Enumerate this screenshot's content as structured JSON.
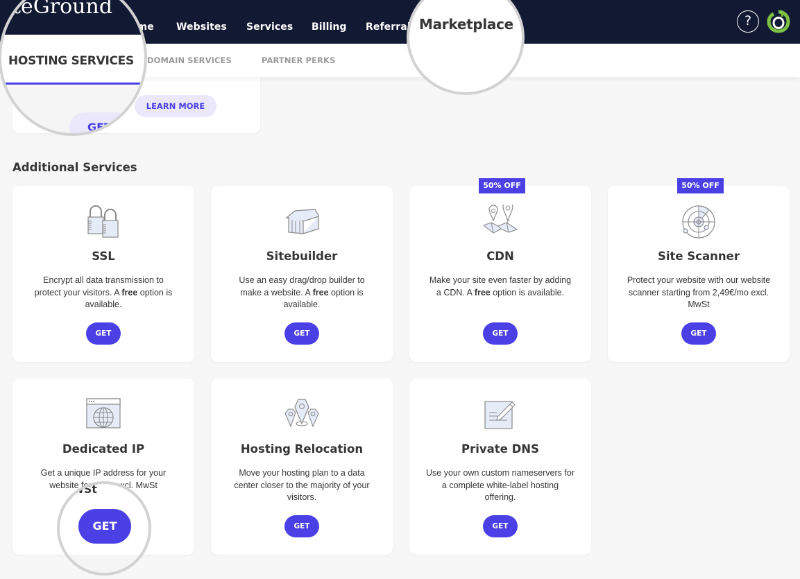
{
  "topnav": {
    "logo_text": "SiteGround",
    "items": [
      {
        "label": "Home"
      },
      {
        "label": "Websites"
      },
      {
        "label": "Services"
      },
      {
        "label": "Billing"
      },
      {
        "label": "Referrals"
      },
      {
        "label": "Marketplace"
      }
    ],
    "help_icon": "?"
  },
  "subnav": {
    "tabs": [
      {
        "label": "HOSTING SERVICES",
        "active": true
      },
      {
        "label": "DOMAIN SERVICES",
        "active": false
      },
      {
        "label": "PARTNER PERKS",
        "active": false
      }
    ]
  },
  "top_card": {
    "learn_more_label": "LEARN MORE",
    "get_label": "GET"
  },
  "section_title": "Additional Services",
  "colors": {
    "nav_bg": "#111933",
    "accent": "#4a40e6",
    "accent_light": "#ebe8fb",
    "page_bg": "#f7f7f7",
    "logo_green": "#7cc142"
  },
  "services": [
    {
      "title": "SSL",
      "desc_pre": "Encrypt all data transmission to protect your visitors. A ",
      "desc_bold": "free",
      "desc_post": " option is available.",
      "badge": "",
      "button": "GET",
      "icon": "padlocks-icon"
    },
    {
      "title": "Sitebuilder",
      "desc_pre": "Use an easy drag/drop builder to make a website. A ",
      "desc_bold": "free",
      "desc_post": " option is available.",
      "badge": "",
      "button": "GET",
      "icon": "house-icon"
    },
    {
      "title": "CDN",
      "desc_pre": "Make your site even faster by adding a CDN. A ",
      "desc_bold": "free",
      "desc_post": " option is available.",
      "badge": "50% OFF",
      "button": "GET",
      "icon": "map-pins-icon"
    },
    {
      "title": "Site Scanner",
      "desc_pre": "Protect your website with our website scanner starting from 2,49€/mo excl. MwSt",
      "desc_bold": "",
      "desc_post": "",
      "badge": "50% OFF",
      "button": "GET",
      "icon": "radar-icon"
    },
    {
      "title": "Dedicated IP",
      "desc_pre": "Get a unique IP address for your website for ",
      "desc_bold": "",
      "desc_post": "€/mo excl. MwSt",
      "badge": "",
      "button": "GET",
      "icon": "browser-globe-icon"
    },
    {
      "title": "Hosting Relocation",
      "desc_pre": "Move your hosting plan to a data center closer to the majority of your visitors.",
      "desc_bold": "",
      "desc_post": "",
      "badge": "",
      "button": "GET",
      "icon": "location-pins-icon"
    },
    {
      "title": "Private DNS",
      "desc_pre": "Use your own custom nameservers for a complete white-label hosting offering.",
      "desc_bold": "",
      "desc_post": "",
      "badge": "",
      "button": "GET",
      "icon": "edit-document-icon"
    }
  ],
  "magnifier_overlays": {
    "logo_fragment": "teGround",
    "tab_label": "HOSTING SERVICES",
    "get_fragment": "GET",
    "marketplace_label": "Marketplace",
    "dedicated_get_label": "GET",
    "dedicated_text_fragment": "MwSt"
  }
}
